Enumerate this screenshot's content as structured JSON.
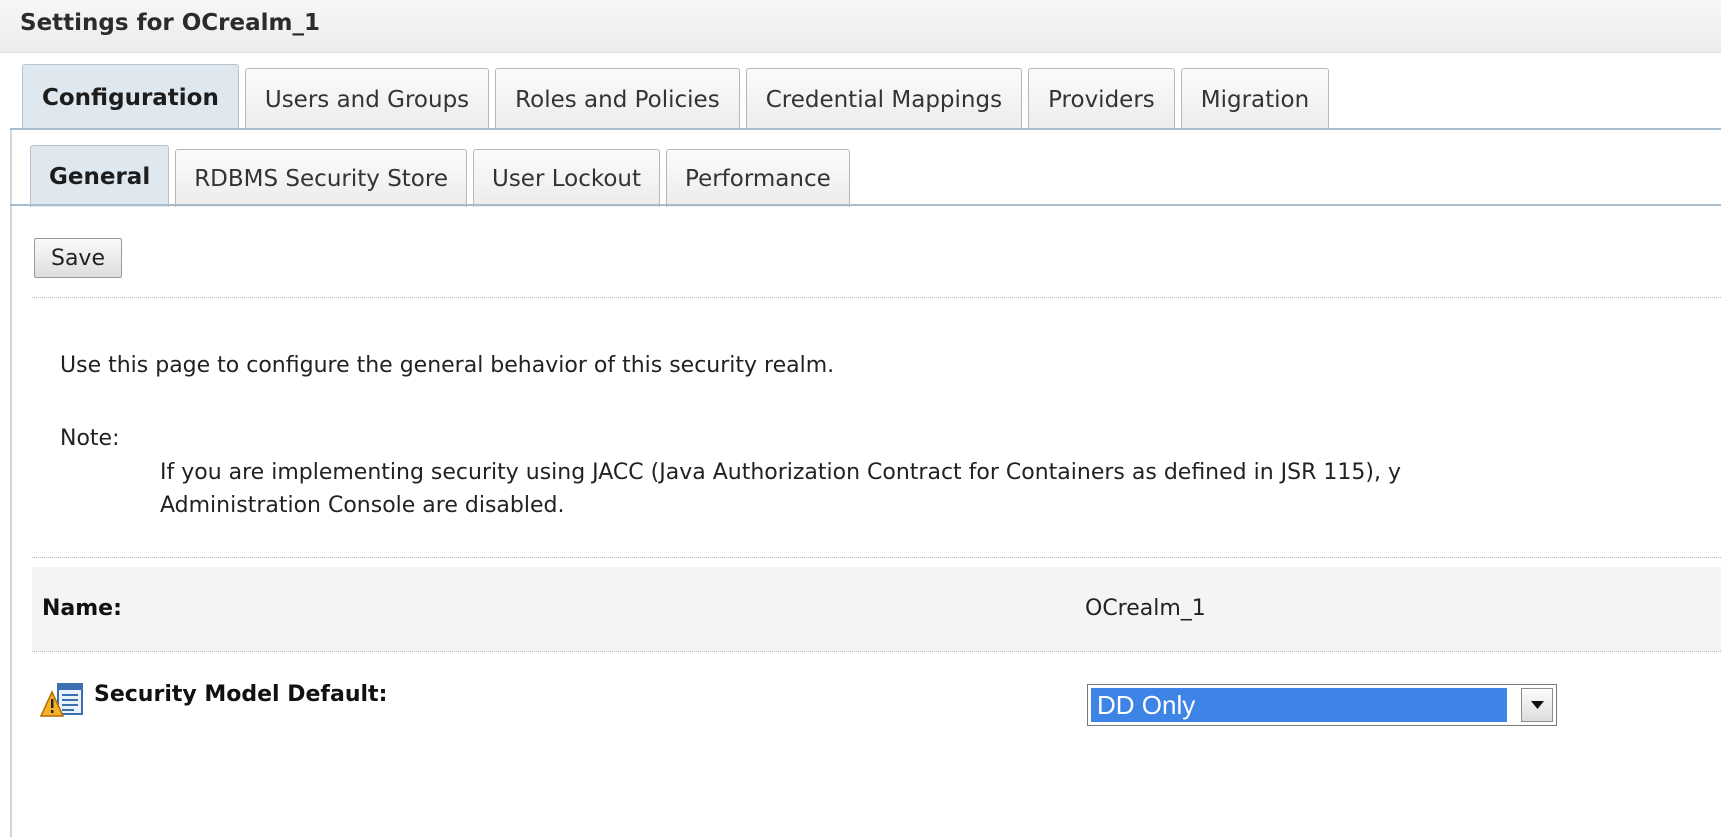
{
  "page": {
    "title": "Settings for OCrealm_1"
  },
  "tabs": {
    "main": [
      {
        "label": "Configuration",
        "active": true
      },
      {
        "label": "Users and Groups",
        "active": false
      },
      {
        "label": "Roles and Policies",
        "active": false
      },
      {
        "label": "Credential Mappings",
        "active": false
      },
      {
        "label": "Providers",
        "active": false
      },
      {
        "label": "Migration",
        "active": false
      }
    ],
    "sub": [
      {
        "label": "General",
        "active": true
      },
      {
        "label": "RDBMS Security Store",
        "active": false
      },
      {
        "label": "User Lockout",
        "active": false
      },
      {
        "label": "Performance",
        "active": false
      }
    ]
  },
  "toolbar": {
    "save_label": "Save"
  },
  "content": {
    "intro": "Use this page to configure the general behavior of this security realm.",
    "note_label": "Note:",
    "note_line1": "If you are implementing security using JACC (Java Authorization Contract for Containers as defined in JSR 115), y",
    "note_line2": "Administration Console are disabled."
  },
  "fields": {
    "name": {
      "label": "Name:",
      "value": "OCrealm_1"
    },
    "security_model_default": {
      "label": "Security Model Default:",
      "selected": "DD Only",
      "icon": "advanced-settings-icon"
    }
  },
  "colors": {
    "active_tab": "#dfe8ef",
    "tab_border": "#a9bccb",
    "selection": "#3d84e6"
  }
}
